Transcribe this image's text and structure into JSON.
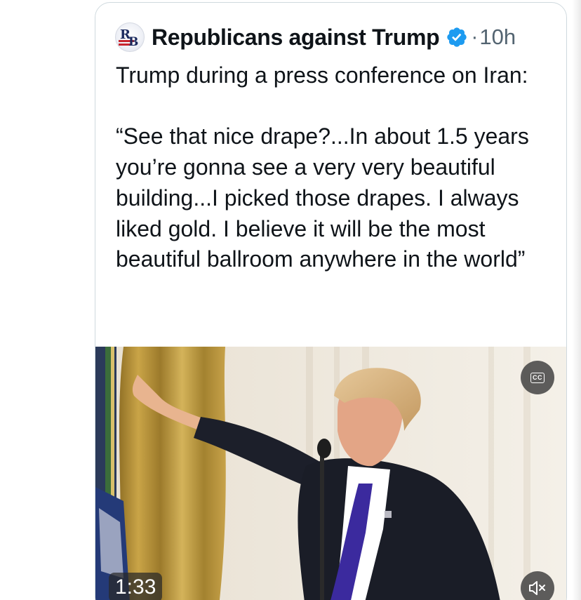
{
  "tweet": {
    "author_name": "Republicans against Trump",
    "separator": "·",
    "timestamp": "10h",
    "text": "Trump during a press conference on Iran:\n\n“See that nice drape?...In about 1.5 years you’re gonna see a very very beautiful building...I picked those drapes. I always liked gold. I believe it will be the most beautiful ballroom anywhere in the world”",
    "avatar_initials": "RB"
  },
  "video": {
    "duration": "1:33",
    "captions_label": "CC",
    "icons": {
      "captions": "closed-captions-icon",
      "mute": "speaker-muted-icon",
      "verified": "verified-badge-icon"
    }
  },
  "colors": {
    "text_primary": "#0f1419",
    "text_secondary": "#536471",
    "verified_blue": "#1d9bf0",
    "card_border": "#cfd9de"
  }
}
